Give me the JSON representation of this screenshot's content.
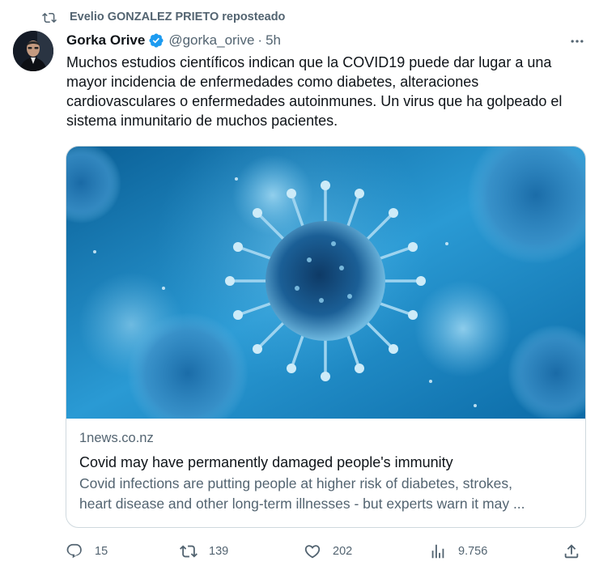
{
  "repost": {
    "text": "Evelio GONZALEZ PRIETO reposteado"
  },
  "author": {
    "name": "Gorka Orive",
    "handle": "@gorka_orive",
    "time": "5h",
    "verified": true
  },
  "tweet": {
    "text": "Muchos estudios científicos indican que la COVID19 puede dar lugar a una mayor incidencia de enfermedades como diabetes, alteraciones cardiovasculares o enfermedades autoinmunes. Un virus que ha golpeado el sistema inmunitario de muchos pacientes."
  },
  "card": {
    "domain": "1news.co.nz",
    "title": "Covid may have permanently damaged people's immunity",
    "description_line1": "Covid infections are putting people at higher risk of diabetes, strokes,",
    "description_line2": "heart disease and other long-term illnesses - but experts warn it may ..."
  },
  "actions": {
    "replies": "15",
    "reposts": "139",
    "likes": "202",
    "views": "9.756"
  },
  "colors": {
    "text": "#0f1419",
    "secondary": "#536471",
    "verified": "#1d9bf0",
    "border": "#cfd9de"
  },
  "icons": [
    "repost-icon",
    "verified-icon",
    "more-icon",
    "reply-icon",
    "like-icon",
    "views-icon",
    "share-icon"
  ]
}
